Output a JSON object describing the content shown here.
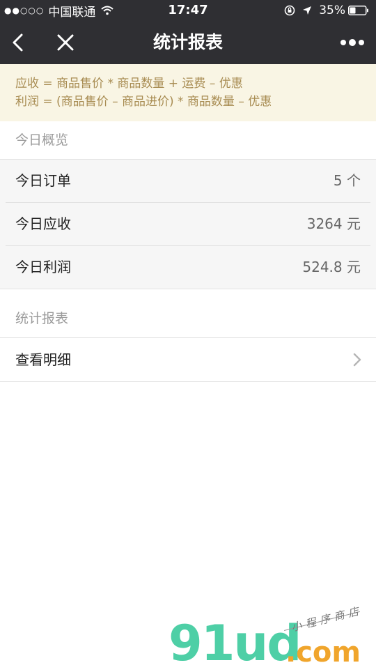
{
  "status_bar": {
    "carrier": "中国联通",
    "time": "17:47",
    "battery": "35%",
    "icons": [
      "signal-dots-icon",
      "wifi-icon",
      "rotation-lock-icon",
      "location-arrow-icon",
      "battery-icon"
    ]
  },
  "nav": {
    "title": "统计报表",
    "icons": [
      "back-icon",
      "close-icon",
      "more-icon"
    ]
  },
  "notice": {
    "line1": "应收 = 商品售价 * 商品数量 + 运费 – 优惠",
    "line2": "利润 = (商品售价 – 商品进价) * 商品数量 – 优惠"
  },
  "overview": {
    "heading": "今日概览",
    "rows": [
      {
        "label": "今日订单",
        "value": "5 个"
      },
      {
        "label": "今日应收",
        "value": "3264 元"
      },
      {
        "label": "今日利润",
        "value": "524.8 元"
      }
    ]
  },
  "report": {
    "heading": "统计报表",
    "link_label": "查看明细",
    "link_icon": "chevron-right-icon"
  },
  "watermark": {
    "brand": "91ud",
    "tld": ".com",
    "tagline": "小程序商店"
  },
  "colors": {
    "bar_bg": "#2f2f33",
    "notice_bg": "#f9f5e4",
    "notice_text": "#a88c52",
    "list_bg": "#f6f6f6",
    "watermark_green": "#4ecfa6",
    "watermark_orange": "#f0a52c"
  }
}
